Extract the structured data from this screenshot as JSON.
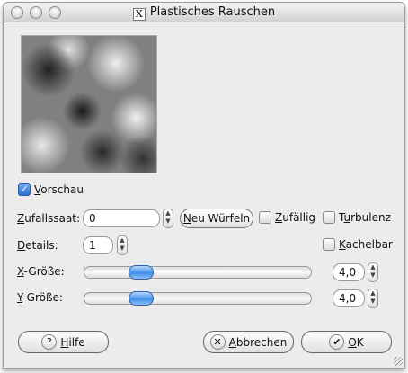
{
  "window": {
    "title": "Plastisches Rauschen",
    "title_icon": "x11-icon"
  },
  "preview": {
    "checkbox_label_u": "V",
    "checkbox_label_rest": "orschau",
    "checked": true
  },
  "seed": {
    "label_u": "Z",
    "label_rest": "ufallssaat:",
    "value": "0",
    "new_seed_u": "N",
    "new_seed_rest": "eu Würfeln"
  },
  "random": {
    "label_u": "Z",
    "label_rest": "ufällig",
    "checked": false
  },
  "turbulent": {
    "label_pre": "T",
    "label_u": "u",
    "label_rest": "rbulenz",
    "checked": false
  },
  "details": {
    "label_u": "D",
    "label_rest": "etails:",
    "value": "1"
  },
  "tileable": {
    "label_u": "K",
    "label_rest": "achelbar",
    "checked": false
  },
  "xsize": {
    "label_u": "X",
    "label_rest": "-Größe:",
    "value": "4,0",
    "fraction": 0.25
  },
  "ysize": {
    "label_u": "Y",
    "label_rest": "-Größe:",
    "value": "4,0",
    "fraction": 0.25
  },
  "buttons": {
    "help_u": "H",
    "help_rest": "ilfe",
    "cancel_u": "A",
    "cancel_rest": "bbrechen",
    "ok_u": "O",
    "ok_rest": "K"
  }
}
